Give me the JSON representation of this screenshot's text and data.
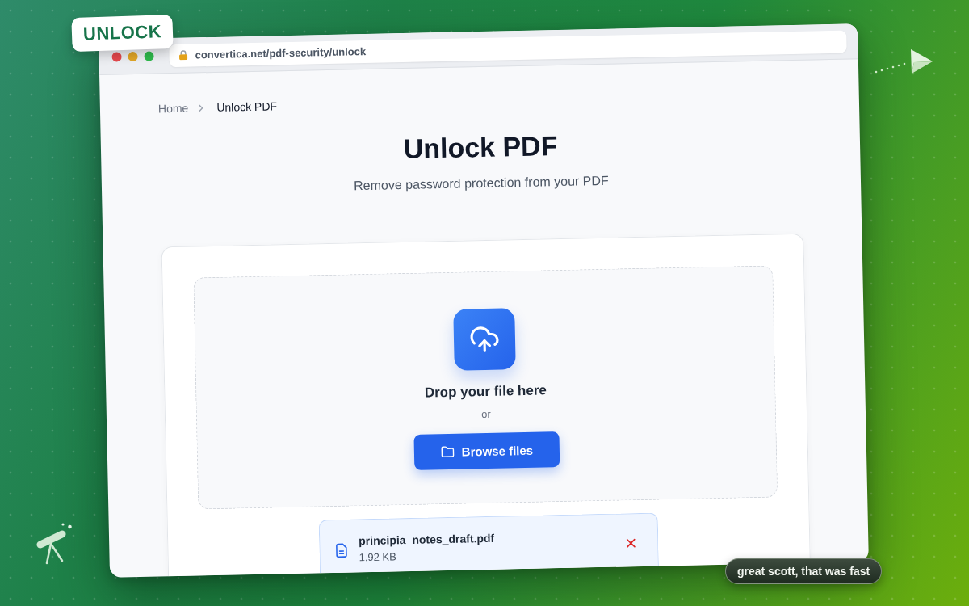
{
  "badge": {
    "label": "UNLOCK"
  },
  "browser": {
    "url": "convertica.net/pdf-security/unlock"
  },
  "breadcrumb": [
    {
      "label": "Home",
      "current": false
    },
    {
      "label": "Unlock PDF",
      "current": true
    }
  ],
  "page": {
    "title": "Unlock PDF",
    "subtitle": "Remove password protection from your PDF"
  },
  "dropzone": {
    "heading": "Drop your file here",
    "separator": "or",
    "button": "Browse files"
  },
  "files": [
    {
      "name": "principia_notes_draft.pdf",
      "size": "1.92 KB"
    }
  ],
  "toast": "great scott, that was fast"
}
